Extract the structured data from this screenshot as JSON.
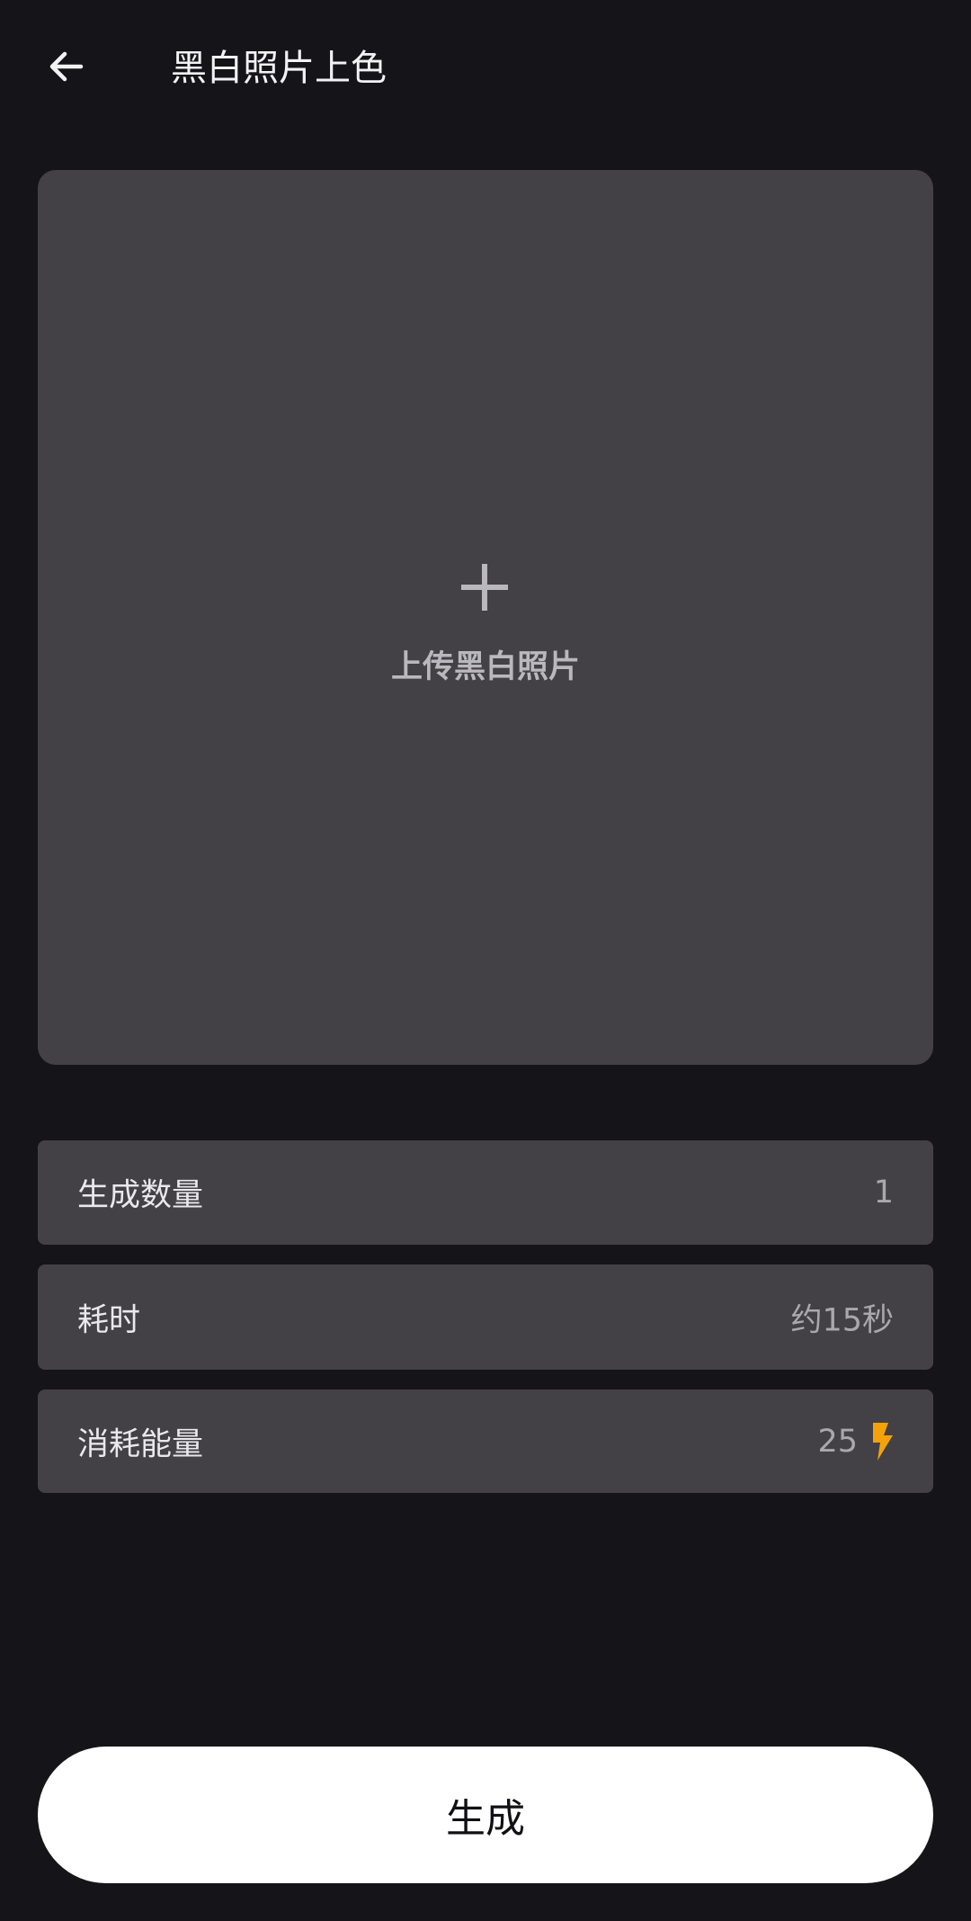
{
  "header": {
    "back_icon": "arrow-left-icon",
    "title": "黑白照片上色"
  },
  "upload": {
    "icon": "plus-icon",
    "label": "上传黑白照片"
  },
  "info_rows": [
    {
      "label": "生成数量",
      "value": "1"
    },
    {
      "label": "耗时",
      "value": "约15秒"
    },
    {
      "label": "消耗能量",
      "value": "25",
      "icon": "lightning-bolt-icon"
    }
  ],
  "actions": {
    "generate_label": "生成"
  },
  "colors": {
    "background": "#151419",
    "card": "#434146",
    "accent_bolt": "#f5a20a",
    "button": "#ffffff"
  }
}
